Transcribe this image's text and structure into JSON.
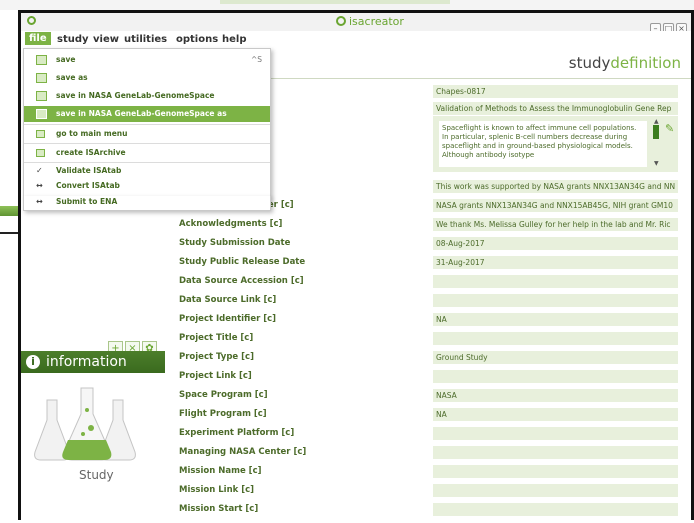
{
  "window": {
    "title": "isacreator"
  },
  "menubar": {
    "items": [
      "file",
      "study",
      "view",
      "utilities",
      "options",
      "help"
    ]
  },
  "dropdown": {
    "items": [
      {
        "label": "save",
        "shortcut": "^S"
      },
      {
        "label": "save as"
      },
      {
        "label": "save in NASA GeneLab-GenomeSpace"
      },
      {
        "label": "save in NASA GeneLab-GenomeSpace as"
      },
      {
        "label": "go to main menu"
      },
      {
        "label": "create ISArchive"
      },
      {
        "label": "Validate ISAtab"
      },
      {
        "label": "Convert ISAtab"
      },
      {
        "label": "Submit to ENA"
      }
    ]
  },
  "header": {
    "title_prefix": "study",
    "title_suffix": "definition"
  },
  "form": {
    "id_value": "Chapes-0817",
    "title_value": "Validation of Methods to Assess the Immunoglobulin Gene Rep",
    "description": "Spaceflight is known to affect immune cell populations. In particular, splenic B-cell numbers decrease during spaceflight and in ground-based physiological models. Although antibody isotype",
    "funding_value": "This work was supported by NASA grants NNX13AN34G and NN",
    "grant_label": "Study Grant Number [c]",
    "grant_value": "NASA grants NNX13AN34G and NNX15AB45G, NIH grant GM10",
    "fields": [
      {
        "label": "Acknowledgments [c]",
        "value": "We thank Ms. Melissa Gulley for her help in the lab and Mr. Ric"
      },
      {
        "label": "Study Submission Date",
        "value": "08-Aug-2017"
      },
      {
        "label": "Study Public Release Date",
        "value": "31-Aug-2017"
      },
      {
        "label": "Data Source Accession [c]",
        "value": ""
      },
      {
        "label": "Data Source Link [c]",
        "value": ""
      },
      {
        "label": "Project Identifier [c]",
        "value": "NA"
      },
      {
        "label": "Project Title [c]",
        "value": ""
      },
      {
        "label": "Project Type [c]",
        "value": "Ground Study"
      },
      {
        "label": "Project Link [c]",
        "value": ""
      },
      {
        "label": "Space Program [c]",
        "value": "NASA"
      },
      {
        "label": "Flight Program [c]",
        "value": "NA"
      },
      {
        "label": "Experiment Platform [c]",
        "value": ""
      },
      {
        "label": "Managing NASA Center [c]",
        "value": ""
      },
      {
        "label": "Mission Name [c]",
        "value": ""
      },
      {
        "label": "Mission Link [c]",
        "value": ""
      },
      {
        "label": "Mission Start [c]",
        "value": ""
      }
    ]
  },
  "info_panel": {
    "title": "information",
    "study_label": "Study"
  },
  "colors": {
    "accent": "#7db345",
    "dark_green": "#3a6a1e",
    "field_bg": "#e8f0dc"
  }
}
